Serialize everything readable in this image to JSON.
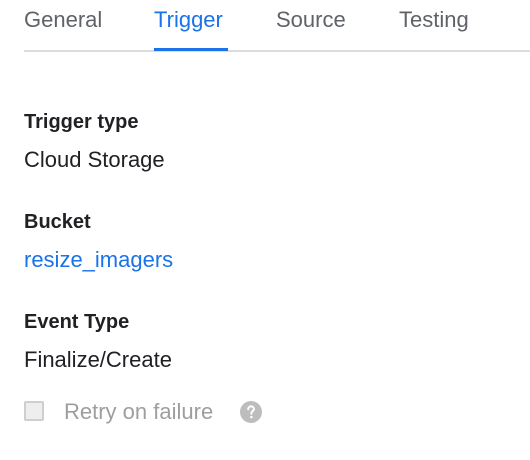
{
  "tabs": [
    {
      "label": "General",
      "active": false
    },
    {
      "label": "Trigger",
      "active": true
    },
    {
      "label": "Source",
      "active": false
    },
    {
      "label": "Testing",
      "active": false
    }
  ],
  "trigger": {
    "trigger_type_label": "Trigger type",
    "trigger_type_value": "Cloud Storage",
    "bucket_label": "Bucket",
    "bucket_value": "resize_imagers",
    "event_type_label": "Event Type",
    "event_type_value": "Finalize/Create",
    "retry": {
      "label": "Retry on failure",
      "checked": false,
      "disabled": true
    }
  },
  "colors": {
    "accent": "#1a73e8",
    "text": "#202124",
    "muted": "#9e9e9e",
    "tab_inactive": "#5f6368"
  },
  "icons": {
    "help": "help-circle-icon"
  }
}
